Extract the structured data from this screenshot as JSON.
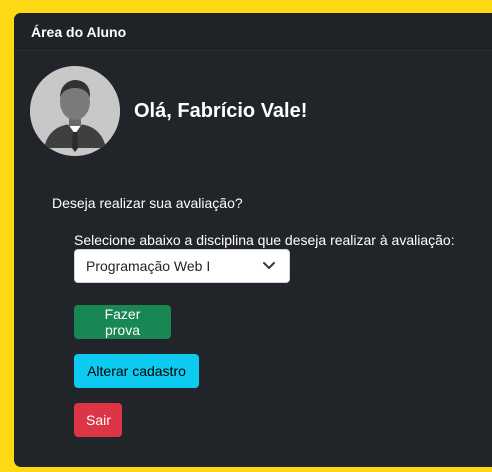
{
  "header": {
    "title": "Área do Aluno"
  },
  "profile": {
    "greeting": "Olá, Fabrício Vale!",
    "avatar_icon": "user-avatar-icon"
  },
  "evaluation": {
    "question": "Deseja realizar sua avaliação?",
    "select_label": "Selecione abaixo a disciplina que deseja realizar à avaliação:",
    "selected_discipline": "Programação Web I"
  },
  "actions": {
    "take_exam": "Fazer prova",
    "edit_profile": "Alterar cadastro",
    "logout": "Sair"
  },
  "colors": {
    "background": "#ffd814",
    "card": "#212529",
    "success": "#198754",
    "info": "#0dcaf0",
    "danger": "#dc3545"
  }
}
